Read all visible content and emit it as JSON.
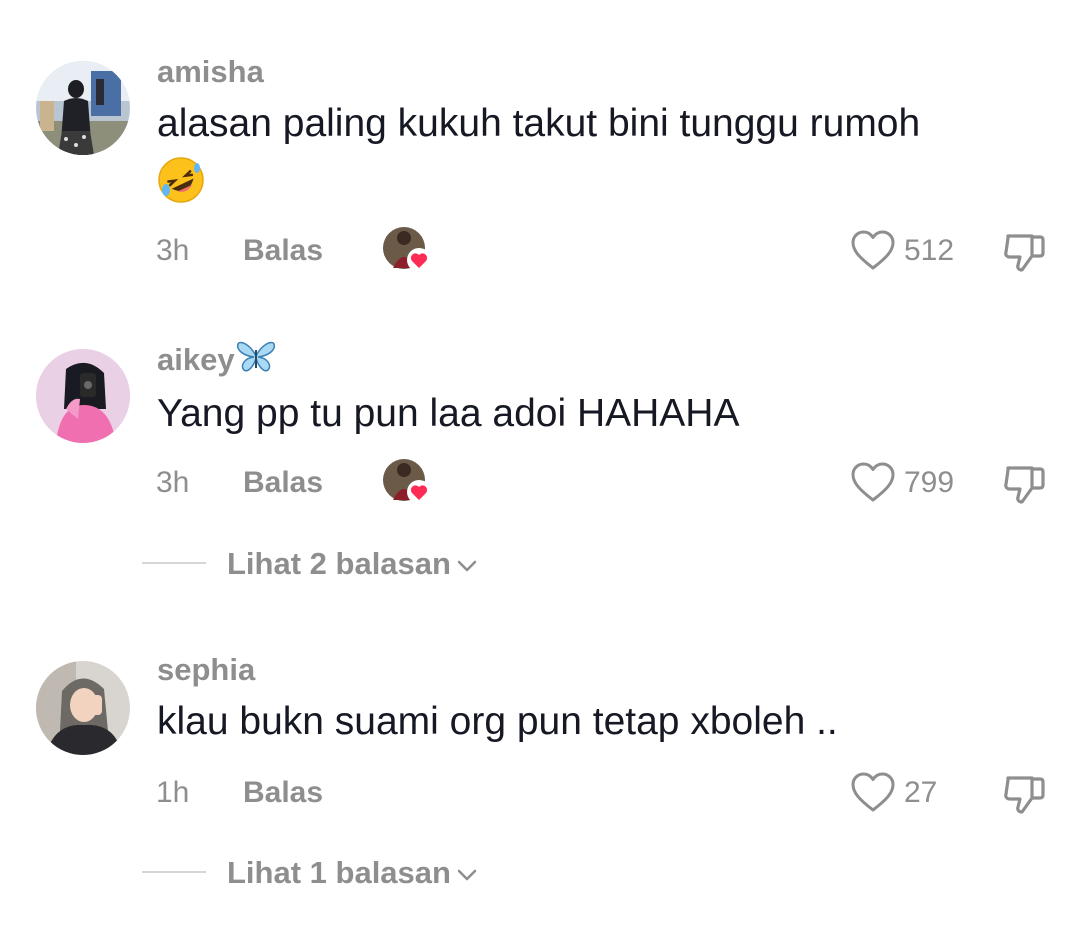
{
  "colors": {
    "text_primary": "#161823",
    "text_muted": "#8e8e8e",
    "heart_red": "#fe2c55",
    "divider": "#d6d6d6"
  },
  "comments": [
    {
      "username": "amisha",
      "text": "alasan paling kukuh takut bini tunggu rumoh",
      "emoji": "rolling-on-floor-laughing",
      "time": "3h",
      "reply_label": "Balas",
      "creator_liked": true,
      "likes": "512"
    },
    {
      "username": "aikey",
      "username_emoji": "butterfly",
      "text": "Yang pp tu pun laa adoi HAHAHA",
      "time": "3h",
      "reply_label": "Balas",
      "creator_liked": true,
      "likes": "799",
      "view_replies": "Lihat 2 balasan"
    },
    {
      "username": "sephia",
      "text": "klau bukn suami org pun tetap xboleh ..",
      "time": "1h",
      "reply_label": "Balas",
      "creator_liked": false,
      "likes": "27",
      "view_replies": "Lihat 1 balasan"
    }
  ],
  "icons": {
    "like": "heart-outline-icon",
    "dislike": "thumbs-down-icon",
    "expand": "chevron-down-icon",
    "creator_like": "creator-liked-badge"
  }
}
